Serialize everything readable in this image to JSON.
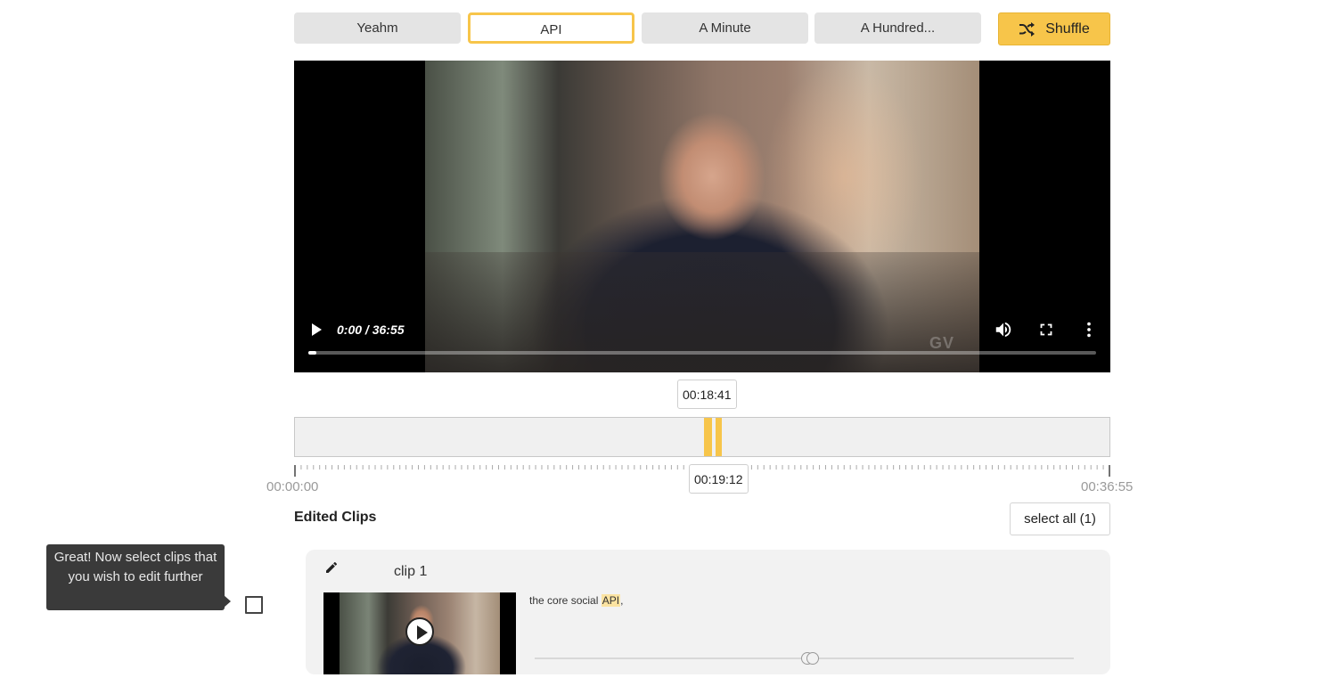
{
  "keywords": {
    "items": [
      {
        "label": "Yeahm",
        "active": false
      },
      {
        "label": "API",
        "active": true
      },
      {
        "label": "A Minute",
        "active": false
      },
      {
        "label": "A Hundred...",
        "active": false
      }
    ],
    "shuffle_label": "Shuffle"
  },
  "video": {
    "time_display": "0:00 / 36:55",
    "watermark": "GV",
    "progress_fraction": 0.01,
    "icons": [
      "play-icon",
      "volume-icon",
      "fullscreen-icon",
      "more-options-icon"
    ]
  },
  "timeline": {
    "start_tip": "00:18:41",
    "end_tip": "00:19:12",
    "start_label": "00:00:00",
    "end_label": "00:36:55",
    "accent_color": "#f7c54a"
  },
  "clips_section": {
    "title": "Edited Clips",
    "select_all_label": "select all (1)"
  },
  "tooltip": {
    "text": "Great! Now select clips that you wish to edit further"
  },
  "clip": {
    "title": "clip 1",
    "text_before": "the core social ",
    "highlight": "API",
    "text_after": ","
  }
}
